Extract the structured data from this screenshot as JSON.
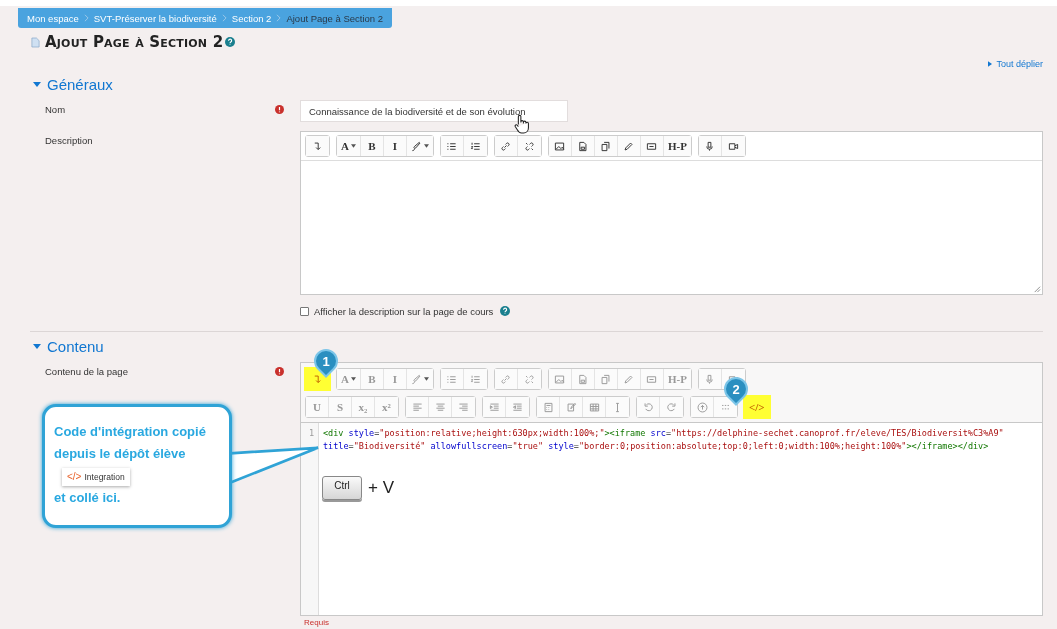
{
  "breadcrumb": [
    {
      "label": "Mon espace",
      "current": false
    },
    {
      "label": "SVT-Préserver la biodiversité",
      "current": false
    },
    {
      "label": "Section 2",
      "current": false
    },
    {
      "label": "Ajout Page à Section 2",
      "current": true
    }
  ],
  "page_title": "Ajout Page à Section 2",
  "expand_all": "Tout déplier",
  "sections": [
    {
      "title": "Généraux",
      "expanded": true,
      "fields": [
        {
          "kind": "text",
          "label": "Nom",
          "required": true,
          "value": "Connaissance de la biodiversité et de son évolution"
        },
        {
          "kind": "editor",
          "label": "Description",
          "required": false,
          "toolbar": {
            "disabled": false,
            "rows": [
              [
                [
                  {
                    "kind": "break",
                    "highlighted": false
                  }
                ],
                [
                  {
                    "kind": "text",
                    "label": "A",
                    "dropdown": true,
                    "highlighted": false
                  },
                  {
                    "kind": "text",
                    "label": "B",
                    "dropdown": false,
                    "highlighted": false
                  },
                  {
                    "kind": "text",
                    "label": "I",
                    "dropdown": false,
                    "highlighted": false
                  },
                  {
                    "kind": "brush",
                    "highlighted": false
                  }
                ],
                [
                  {
                    "kind": "ul",
                    "highlighted": false
                  },
                  {
                    "kind": "ol",
                    "highlighted": false
                  }
                ],
                [
                  {
                    "kind": "link",
                    "highlighted": false
                  },
                  {
                    "kind": "unlink",
                    "highlighted": false
                  }
                ],
                [
                  {
                    "kind": "image",
                    "highlighted": false
                  },
                  {
                    "kind": "media",
                    "highlighted": false
                  },
                  {
                    "kind": "files",
                    "highlighted": false
                  },
                  {
                    "kind": "pencil",
                    "highlighted": false
                  },
                  {
                    "kind": "screen",
                    "highlighted": false
                  },
                  {
                    "kind": "text",
                    "label": "H-P",
                    "dropdown": false,
                    "highlighted": false
                  }
                ],
                [
                  {
                    "kind": "mic",
                    "highlighted": false
                  },
                  {
                    "kind": "video",
                    "highlighted": false
                  }
                ]
              ]
            ]
          }
        },
        {
          "kind": "checkbox",
          "label": "Afficher la description sur la page de cours",
          "checked": false,
          "help": true
        }
      ]
    },
    {
      "title": "Contenu",
      "expanded": true,
      "fields": [
        {
          "kind": "code_editor",
          "label": "Contenu de la page",
          "required": true,
          "toolbar": {
            "disabled": true,
            "rows": [
              [
                [
                  {
                    "kind": "break",
                    "highlighted": true
                  }
                ],
                [
                  {
                    "kind": "text",
                    "label": "A",
                    "dropdown": true,
                    "highlighted": false
                  },
                  {
                    "kind": "text",
                    "label": "B",
                    "dropdown": false,
                    "highlighted": false
                  },
                  {
                    "kind": "text",
                    "label": "I",
                    "dropdown": false,
                    "highlighted": false
                  },
                  {
                    "kind": "brush",
                    "highlighted": false
                  }
                ],
                [
                  {
                    "kind": "ul",
                    "highlighted": false
                  },
                  {
                    "kind": "ol",
                    "highlighted": false
                  }
                ],
                [
                  {
                    "kind": "link",
                    "highlighted": false
                  },
                  {
                    "kind": "unlink",
                    "highlighted": false
                  }
                ],
                [
                  {
                    "kind": "image",
                    "highlighted": false
                  },
                  {
                    "kind": "media",
                    "highlighted": false
                  },
                  {
                    "kind": "files",
                    "highlighted": false
                  },
                  {
                    "kind": "pencil",
                    "highlighted": false
                  },
                  {
                    "kind": "screen",
                    "highlighted": false
                  },
                  {
                    "kind": "text",
                    "label": "H-P",
                    "dropdown": false,
                    "highlighted": false
                  }
                ],
                [
                  {
                    "kind": "mic",
                    "highlighted": false
                  },
                  {
                    "kind": "video",
                    "highlighted": false
                  }
                ]
              ],
              [
                [
                  {
                    "kind": "text",
                    "label": "U",
                    "dropdown": false,
                    "highlighted": false
                  },
                  {
                    "kind": "text",
                    "label": "S",
                    "dropdown": false,
                    "highlighted": false
                  },
                  {
                    "kind": "text",
                    "label": "x₂",
                    "dropdown": false,
                    "highlighted": false
                  },
                  {
                    "kind": "text",
                    "label": "x²",
                    "dropdown": false,
                    "highlighted": false
                  }
                ],
                [
                  {
                    "kind": "align-left",
                    "highlighted": false
                  },
                  {
                    "kind": "align-center",
                    "highlighted": false
                  },
                  {
                    "kind": "align-right",
                    "highlighted": false
                  }
                ],
                [
                  {
                    "kind": "indent",
                    "highlighted": false
                  },
                  {
                    "kind": "outdent",
                    "highlighted": false
                  }
                ],
                [
                  {
                    "kind": "calc",
                    "highlighted": false
                  },
                  {
                    "kind": "edit",
                    "highlighted": false
                  },
                  {
                    "kind": "table",
                    "highlighted": false
                  },
                  {
                    "kind": "cursor",
                    "highlighted": false
                  }
                ],
                [
                  {
                    "kind": "undo",
                    "highlighted": false
                  },
                  {
                    "kind": "redo",
                    "highlighted": false
                  }
                ],
                [
                  {
                    "kind": "upload",
                    "highlighted": false
                  },
                  {
                    "kind": "grid",
                    "highlighted": false
                  }
                ],
                [
                  {
                    "kind": "text",
                    "label": "</>",
                    "dropdown": false,
                    "highlighted": true
                  }
                ]
              ]
            ]
          },
          "lines": [
            {
              "number": "1",
              "tokens": [
                {
                  "kind": "tag",
                  "text": "<div"
                },
                {
                  "kind": "attr",
                  "text": " style"
                },
                {
                  "kind": "plain",
                  "text": "="
                },
                {
                  "kind": "string",
                  "text": "\"position:relative;height:630px;width:100%;\""
                },
                {
                  "kind": "tag",
                  "text": "><iframe"
                },
                {
                  "kind": "attr",
                  "text": " src"
                },
                {
                  "kind": "plain",
                  "text": "="
                },
                {
                  "kind": "string",
                  "text": "\"https://delphine-sechet.canoprof.fr/eleve/TES/Biodiversit%C3%A9\""
                }
              ]
            },
            {
              "tokens": [
                {
                  "kind": "attr",
                  "text": "title"
                },
                {
                  "kind": "plain",
                  "text": "="
                },
                {
                  "kind": "string",
                  "text": "\"Biodiversité\""
                },
                {
                  "kind": "attr",
                  "text": " allowfullscreen"
                },
                {
                  "kind": "plain",
                  "text": "="
                },
                {
                  "kind": "string",
                  "text": "\"true\""
                },
                {
                  "kind": "attr",
                  "text": " style"
                },
                {
                  "kind": "plain",
                  "text": "="
                },
                {
                  "kind": "string",
                  "text": "\"border:0;position:absolute;top:0;left:0;width:100%;height:100%\""
                },
                {
                  "kind": "tag",
                  "text": "></iframe></div>"
                }
              ]
            }
          ]
        }
      ]
    }
  ],
  "required_note": "Requis",
  "annotations": {
    "markers": [
      {
        "number": "1"
      },
      {
        "number": "2"
      }
    ],
    "callout": {
      "text_before": "Code d'intégration copié depuis le dépôt élève",
      "chip_code": "</>",
      "chip_label": "Integration",
      "text_after": "et collé ici."
    },
    "shortcut": {
      "key": "Ctrl",
      "plus": "+ V"
    }
  }
}
